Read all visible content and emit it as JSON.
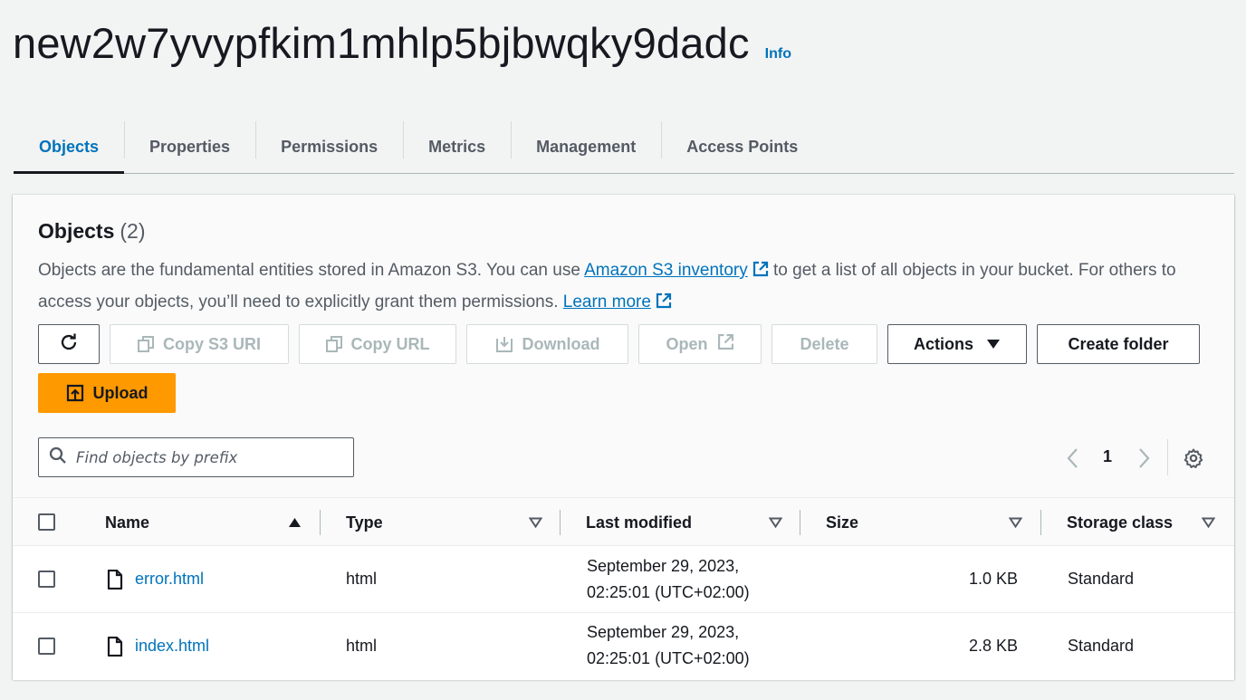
{
  "header": {
    "title": "new2w7yvypfkim1mhlp5bjbwqky9dadc",
    "info_label": "Info"
  },
  "tabs": [
    {
      "label": "Objects",
      "active": true
    },
    {
      "label": "Properties"
    },
    {
      "label": "Permissions"
    },
    {
      "label": "Metrics"
    },
    {
      "label": "Management"
    },
    {
      "label": "Access Points"
    }
  ],
  "objects_panel": {
    "title": "Objects",
    "count": "(2)",
    "description": {
      "part1": "Objects are the fundamental entities stored in Amazon S3. You can use ",
      "inventory_link": "Amazon S3 inventory",
      "part2": " to get a list of all objects in your bucket. For others to access your objects, you’ll need to explicitly grant them permissions. ",
      "learn_more": "Learn more"
    }
  },
  "toolbar": {
    "copy_s3_uri": "Copy S3 URI",
    "copy_url": "Copy URL",
    "download": "Download",
    "open": "Open",
    "delete": "Delete",
    "actions": "Actions",
    "create_folder": "Create folder",
    "upload": "Upload"
  },
  "search": {
    "placeholder": "Find objects by prefix"
  },
  "pagination": {
    "current_page": "1"
  },
  "table": {
    "columns": [
      "Name",
      "Type",
      "Last modified",
      "Size",
      "Storage class"
    ],
    "rows": [
      {
        "name": "error.html",
        "type": "html",
        "modified_date": "September 29, 2023,",
        "modified_time": "02:25:01 (UTC+02:00)",
        "size": "1.0 KB",
        "storage_class": "Standard"
      },
      {
        "name": "index.html",
        "type": "html",
        "modified_date": "September 29, 2023,",
        "modified_time": "02:25:01 (UTC+02:00)",
        "size": "2.8 KB",
        "storage_class": "Standard"
      }
    ]
  },
  "colors": {
    "link": "#0073bb",
    "primary_button": "#ff9900",
    "text": "#16191f",
    "muted": "#545b64"
  }
}
